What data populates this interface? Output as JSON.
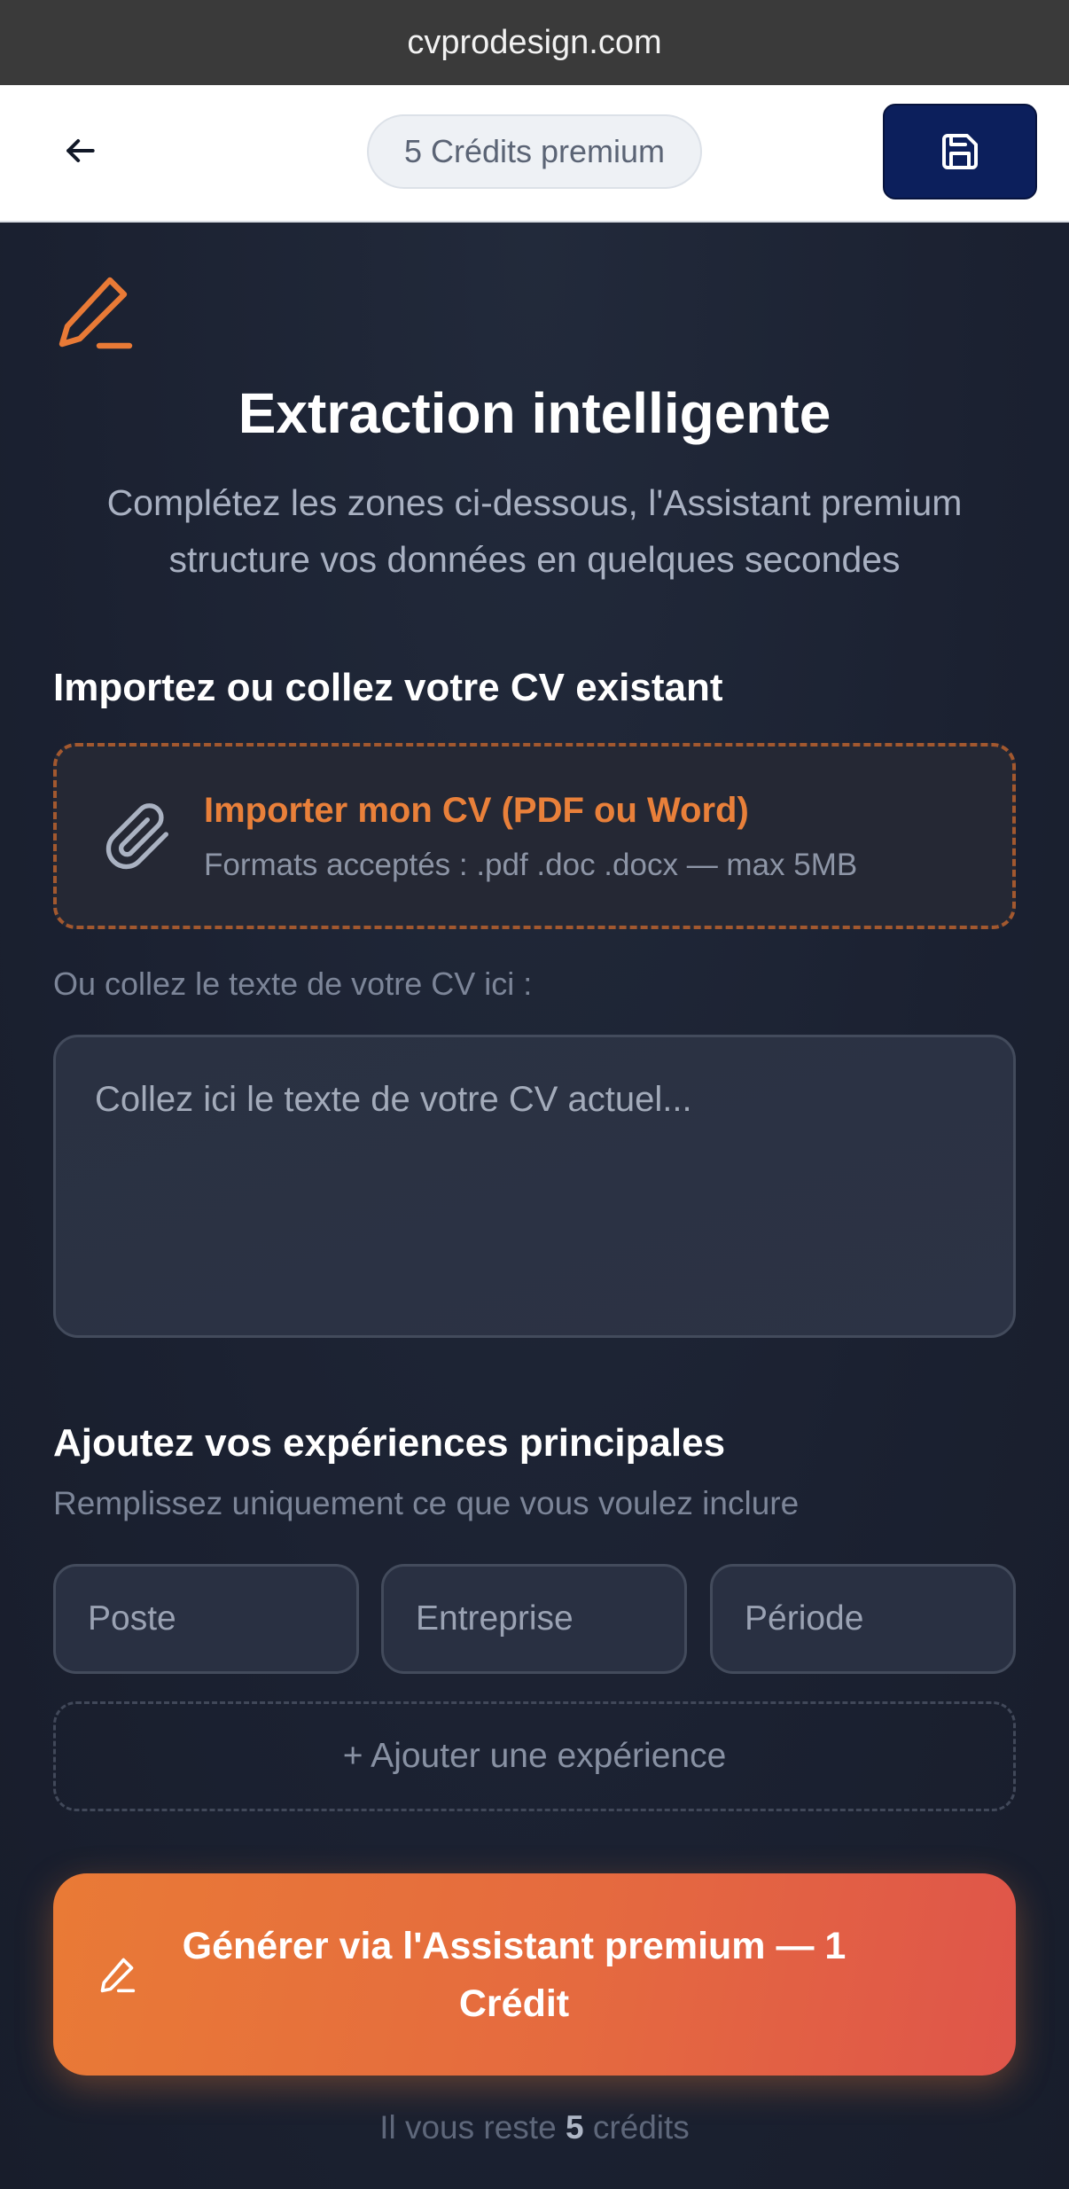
{
  "browser": {
    "url": "cvprodesign.com"
  },
  "header": {
    "back_icon": "arrow-left-icon",
    "credits_label": "5 Crédits premium",
    "save_icon": "floppy-disk-icon"
  },
  "hero": {
    "icon": "pen-icon",
    "title": "Extraction intelligente",
    "subtitle": "Complétez les zones ci-dessous, l'Assistant premium structure vos données en quelques secondes"
  },
  "import_section": {
    "title": "Importez ou collez votre CV existant",
    "upload": {
      "icon": "paperclip-icon",
      "title": "Importer mon CV (PDF ou Word)",
      "subtitle": "Formats acceptés : .pdf .doc .docx — max 5MB"
    },
    "paste_label": "Ou collez le texte de votre CV ici :",
    "paste_value": "",
    "paste_placeholder": "Collez ici le texte de votre CV actuel..."
  },
  "experience_section": {
    "title": "Ajoutez vos expériences principales",
    "hint": "Remplissez uniquement ce que vous voulez inclure",
    "fields": {
      "position_placeholder": "Poste",
      "company_placeholder": "Entreprise",
      "period_placeholder": "Période"
    },
    "add_label": "+ Ajouter une expérience"
  },
  "generate": {
    "icon": "pen-icon",
    "label": "Générer via l'Assistant premium — 1 Crédit"
  },
  "footer": {
    "remaining_prefix": "Il vous reste",
    "remaining_count": "5",
    "remaining_suffix": "crédits"
  },
  "colors": {
    "accent": "#e97a36",
    "save_button": "#0c1f5c",
    "background": "#1a2030"
  }
}
